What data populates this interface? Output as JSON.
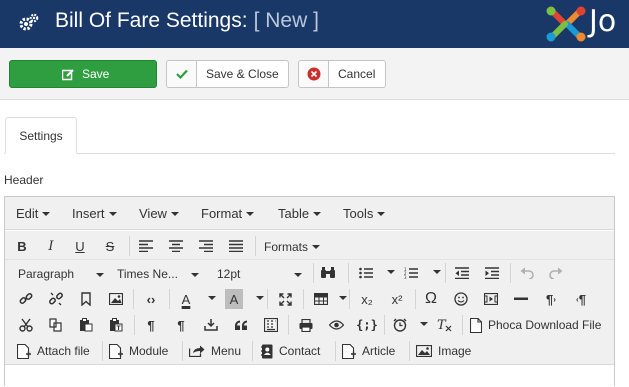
{
  "header": {
    "title": "Bill Of Fare Settings:",
    "state": "[ New ]",
    "logo_text": "Jo",
    "brand_colors": {
      "bar": "#1a3867",
      "logo_red": "#e0432f",
      "logo_orange": "#f1892d",
      "logo_green": "#7ac143",
      "logo_blue": "#1c9ad6"
    }
  },
  "toolbar": {
    "save_label": "Save",
    "save_close_label": "Save & Close",
    "cancel_label": "Cancel",
    "colors": {
      "save": "#2f9e41",
      "cancel_icon": "#c9302c"
    }
  },
  "tabs": [
    {
      "label": "Settings",
      "active": true
    }
  ],
  "field": {
    "label": "Header"
  },
  "editor": {
    "menus": [
      "Edit",
      "Insert",
      "View",
      "Format",
      "Table",
      "Tools"
    ],
    "formats_label": "Formats",
    "block_format": "Paragraph",
    "font_family": "Times Ne...",
    "font_size": "12pt",
    "plugins": {
      "phoca_download_file": "Phoca Download File",
      "attach_file": "Attach file",
      "module": "Module",
      "menu": "Menu",
      "contact": "Contact",
      "article": "Article",
      "image": "Image"
    },
    "glyphs": {
      "bold": "B",
      "italic": "I",
      "underline": "U",
      "strikethrough": "S",
      "code": "‹›",
      "font_color": "A",
      "background_color": "A",
      "subscript": "x₂",
      "superscript": "x²",
      "omega": "Ω",
      "paragraph_mark": "¶",
      "quote": "66",
      "code_sample": "{;}"
    }
  }
}
